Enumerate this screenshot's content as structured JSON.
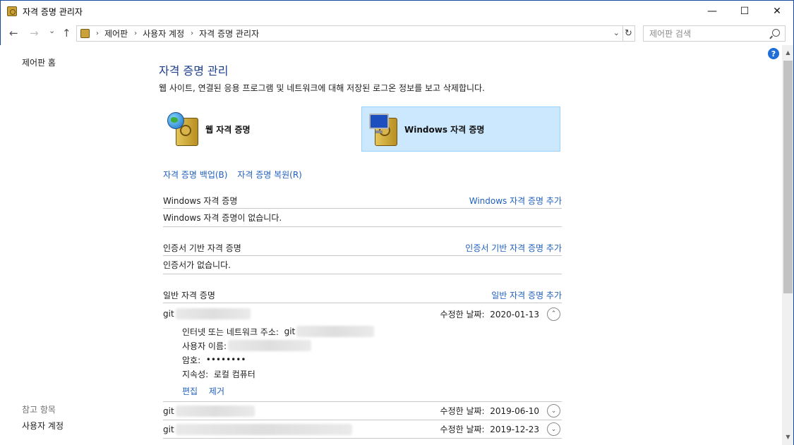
{
  "window": {
    "title": "자격 증명 관리자",
    "controls": {
      "minimize": "—",
      "maximize": "☐",
      "close": "✕"
    }
  },
  "nav": {
    "back": "←",
    "forward": "→",
    "recent": "⌄",
    "up": "↑",
    "breadcrumbs": [
      "제어판",
      "사용자 계정",
      "자격 증명 관리자"
    ],
    "dropdown": "⌄",
    "refresh": "↻",
    "search_placeholder": "제어판 검색"
  },
  "help": "?",
  "left_pane": {
    "home": "제어판 홈",
    "see_also_label": "참고 항목",
    "see_also_items": [
      "사용자 계정"
    ]
  },
  "main": {
    "title": "자격 증명 관리",
    "description": "웹 사이트, 연결된 응용 프로그램 및 네트워크에 대해 저장된 로그온 정보를 보고 삭제합니다.",
    "tiles": [
      {
        "label": "웹 자격 증명",
        "icon": "web-credential-icon",
        "selected": false
      },
      {
        "label": "Windows 자격 증명",
        "icon": "windows-credential-icon",
        "selected": true
      }
    ],
    "backup_link": "자격 증명 백업(B)",
    "restore_link": "자격 증명 복원(R)",
    "sections": {
      "windows": {
        "title": "Windows 자격 증명",
        "add": "Windows 자격 증명 추가",
        "empty": "Windows 자격 증명이 없습니다."
      },
      "certificate": {
        "title": "인증서 기반 자격 증명",
        "add": "인증서 기반 자격 증명 추가",
        "empty": "인증서가 없습니다."
      },
      "generic": {
        "title": "일반 자격 증명",
        "add": "일반 자격 증명 추가"
      }
    },
    "credentials": [
      {
        "name_prefix": "git",
        "modified_label": "수정한 날짜:",
        "modified_date": "2020-01-13",
        "expanded": true,
        "details": {
          "address_label": "인터넷 또는 네트워크 주소:",
          "address_prefix": "git",
          "username_label": "사용자 이름:",
          "password_label": "암호:",
          "password_value": "••••••••",
          "persistence_label": "지속성:",
          "persistence_value": "로컬 컴퓨터"
        },
        "edit": "편집",
        "remove": "제거"
      },
      {
        "name_prefix": "git",
        "modified_label": "수정한 날짜:",
        "modified_date": "2019-06-10",
        "expanded": false
      },
      {
        "name_prefix": "git",
        "modified_label": "수정한 날짜:",
        "modified_date": "2019-12-23",
        "expanded": false
      }
    ],
    "chevron_expanded": "⌃",
    "chevron_collapsed": "⌄"
  },
  "colors": {
    "accent_blue": "#1f5fbf",
    "title_blue": "#1e3f8e",
    "selected_tile": "#cce8ff",
    "window_border": "#1a4a9e"
  }
}
